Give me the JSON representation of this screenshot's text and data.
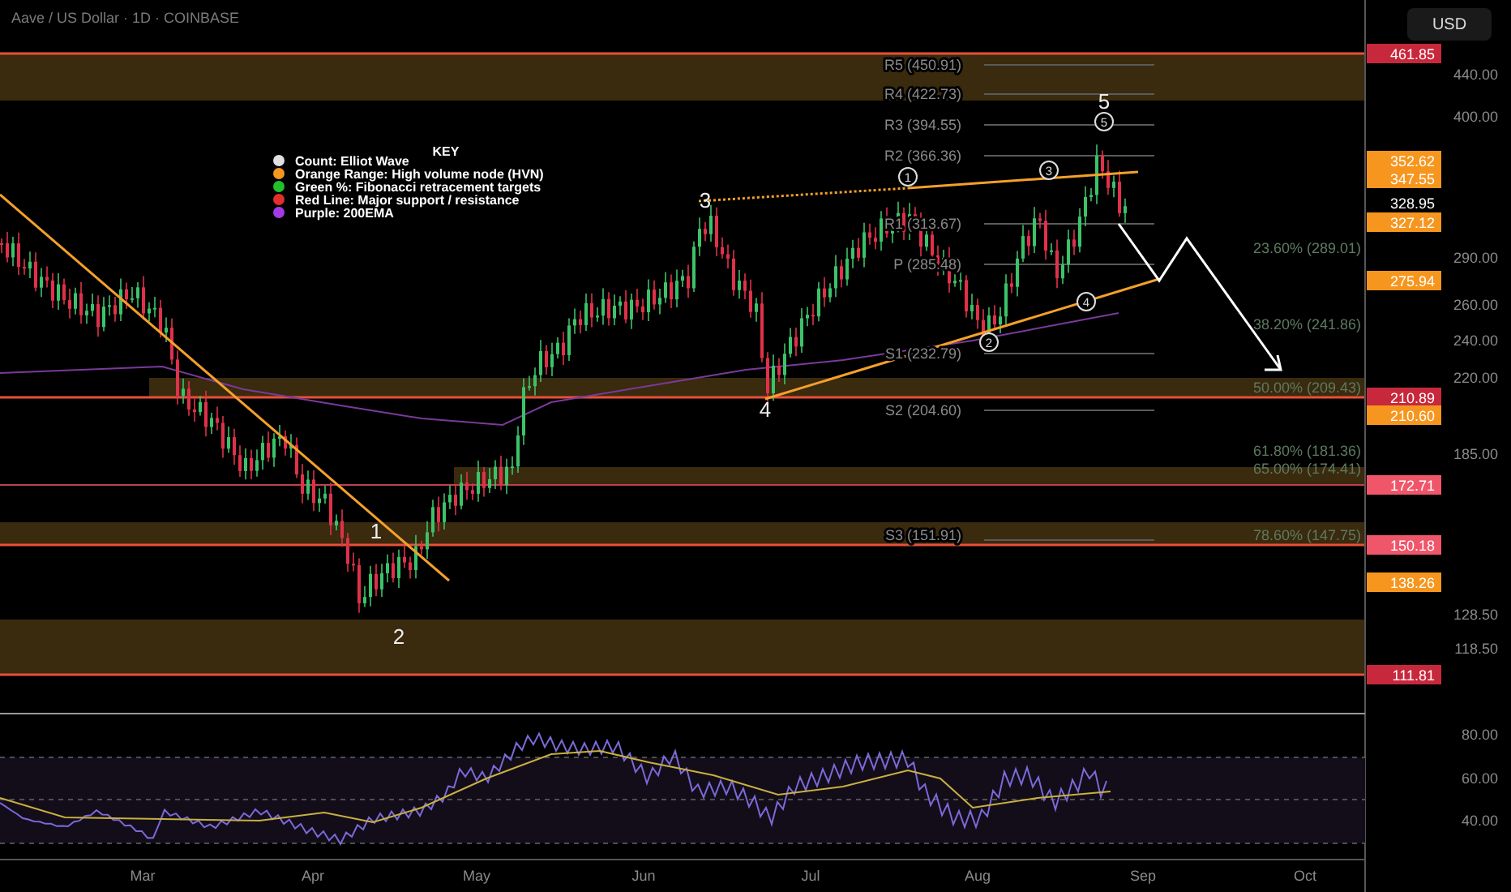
{
  "header": {
    "title": "Aave / US Dollar · 1D · COINBASE"
  },
  "currency_button": {
    "label": "USD"
  },
  "key": {
    "title": "KEY",
    "items": [
      {
        "label": "Count: Elliot Wave",
        "color": "#e0e0e0"
      },
      {
        "label": "Orange Range: High volume node (HVN)",
        "color": "#f5961e"
      },
      {
        "label": "Green %: Fibonacci retracement targets",
        "color": "#22c02a"
      },
      {
        "label": "Red Line: Major support / resistance",
        "color": "#e0302a"
      },
      {
        "label": "Purple: 200EMA",
        "color": "#a43ae6"
      }
    ]
  },
  "pivot_levels": [
    "R5 (450.91)",
    "R4 (422.73)",
    "R3 (394.55)",
    "R2 (366.36)",
    "R1 (313.67)",
    "P (285.48)",
    "S1 (232.79)",
    "S2 (204.60)",
    "S3 (151.91)"
  ],
  "fib_levels": [
    "23.60% (289.01)",
    "38.20% (241.86)",
    "50.00% (209.43)",
    "61.80% (181.36)",
    "65.00% (174.41)",
    "78.60% (147.75)"
  ],
  "wave_labels": [
    {
      "label": "1",
      "kind": "plain"
    },
    {
      "label": "2",
      "kind": "plain"
    },
    {
      "label": "3",
      "kind": "plain"
    },
    {
      "label": "4",
      "kind": "plain"
    },
    {
      "label": "1",
      "kind": "circled"
    },
    {
      "label": "2",
      "kind": "circled"
    },
    {
      "label": "3",
      "kind": "circled"
    },
    {
      "label": "4",
      "kind": "circled"
    },
    {
      "label": "5",
      "kind": "circled"
    },
    {
      "label": "5",
      "kind": "plain"
    }
  ],
  "price_axis": {
    "ticks": [
      "440.00",
      "400.00",
      "290.00",
      "260.00",
      "240.00",
      "220.00",
      "185.00",
      "128.50",
      "118.50"
    ],
    "markers": [
      {
        "label": "461.85",
        "kind": "badge",
        "color": "#c8283c"
      },
      {
        "label": "352.62",
        "kind": "badge",
        "color": "#f7961e"
      },
      {
        "label": "347.55",
        "kind": "badge",
        "color": "#f7961e"
      },
      {
        "label": "328.95",
        "kind": "price"
      },
      {
        "label": "327.12",
        "kind": "badge",
        "color": "#f7961e"
      },
      {
        "label": "275.94",
        "kind": "badge",
        "color": "#f7961e"
      },
      {
        "label": "210.89",
        "kind": "badge",
        "color": "#c8283c"
      },
      {
        "label": "210.60",
        "kind": "badge",
        "color": "#f7961e"
      },
      {
        "label": "172.71",
        "kind": "badge",
        "color": "#f0566a"
      },
      {
        "label": "150.18",
        "kind": "badge",
        "color": "#f0566a"
      },
      {
        "label": "138.26",
        "kind": "badge",
        "color": "#f7961e"
      },
      {
        "label": "111.81",
        "kind": "badge",
        "color": "#c8283c"
      }
    ]
  },
  "time_axis": [
    "Mar",
    "Apr",
    "May",
    "Jun",
    "Jul",
    "Aug",
    "Sep",
    "Oct"
  ],
  "rsi": {
    "ticks": [
      "80.00",
      "60.00",
      "40.00"
    ]
  }
}
